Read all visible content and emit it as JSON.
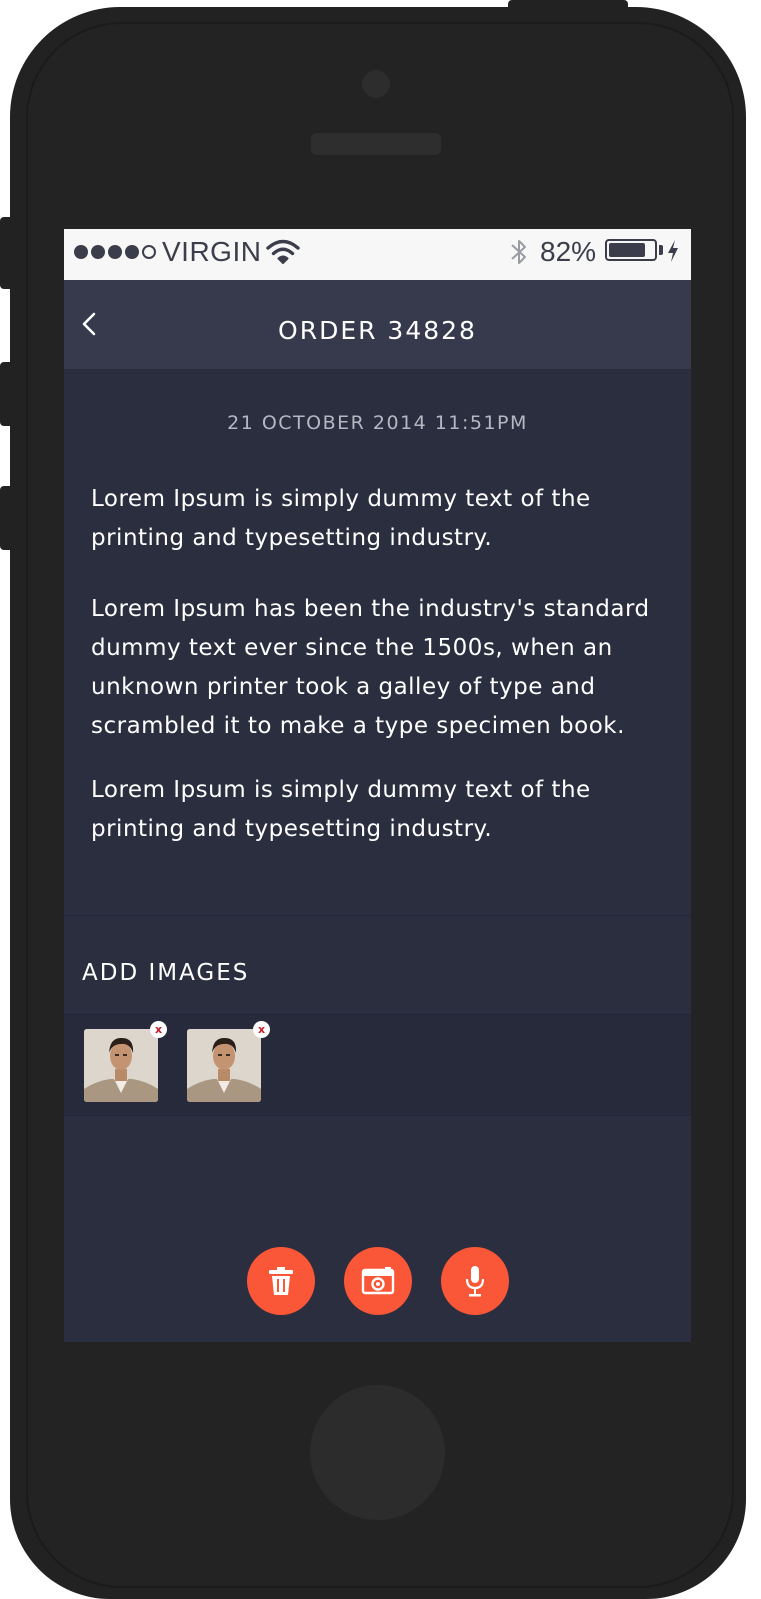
{
  "status_bar": {
    "signal_bars": 5,
    "signal_filled": 4,
    "carrier": "VIRGIN",
    "battery_percent": "82%",
    "battery_level": 0.82,
    "icons": [
      "wifi-icon",
      "bluetooth-icon",
      "battery-icon",
      "charging-bolt-icon"
    ]
  },
  "header": {
    "title": "ORDER 34828",
    "back_icon": "chevron-left-icon"
  },
  "order": {
    "date": "21 OCTOBER 2014 11:51PM",
    "paragraphs": [
      "Lorem Ipsum is simply dummy text of the printing and typesetting industry.",
      "Lorem Ipsum has been the industry's standard dummy text ever since the 1500s, when an unknown printer took a galley of type and scrambled it to make a type specimen book.",
      "Lorem Ipsum is simply dummy text of the printing and typesetting industry."
    ]
  },
  "images_section": {
    "title": "ADD IMAGES",
    "remove_label": "x",
    "images": [
      "photo-1",
      "photo-2"
    ]
  },
  "actions": {
    "buttons": [
      "trash-icon",
      "camera-icon",
      "microphone-icon"
    ],
    "accent_color": "#fa5638"
  },
  "colors": {
    "screen_bg": "#2b2e3f",
    "nav_bg": "#373a4d",
    "status_bg": "#f7f7f7"
  }
}
